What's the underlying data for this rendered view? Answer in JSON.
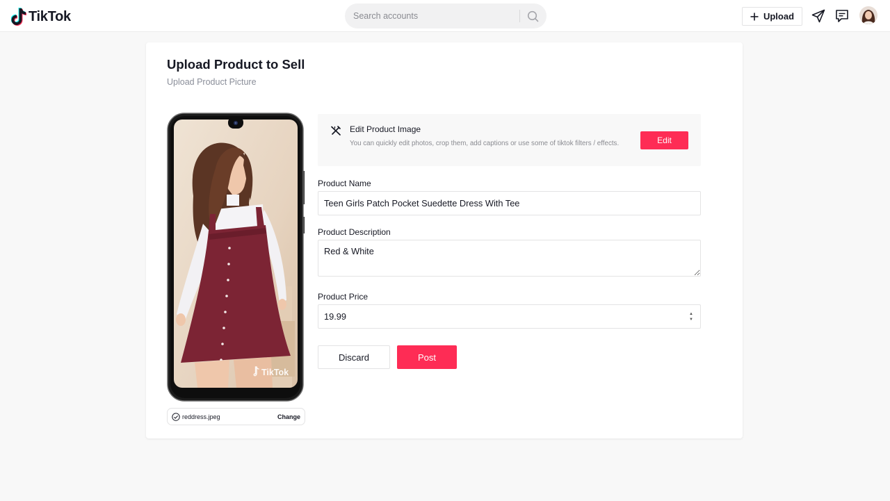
{
  "header": {
    "logo_text": "TikTok",
    "search_placeholder": "Search accounts",
    "upload_label": "Upload",
    "brand_color": "#fe2c55",
    "icons": [
      "tiktok-logo-icon",
      "search-icon",
      "plus-icon",
      "send-icon",
      "message-icon",
      "avatar"
    ]
  },
  "main": {
    "title": "Upload Product to Sell",
    "subtitle": "Upload Product Picture",
    "preview": {
      "watermark": "TikTok",
      "file_name": "reddress.jpeg",
      "change_label": "Change"
    },
    "edit_panel": {
      "title": "Edit Product Image",
      "description": "You can quickly edit photos, crop them, add captions or use some of tiktok filters / effects.",
      "button_label": "Edit"
    },
    "form": {
      "name_label": "Product Name",
      "name_value": "Teen Girls Patch Pocket Suedette Dress With Tee",
      "description_label": "Product Description",
      "description_value": "Red & White",
      "price_label": "Product Price",
      "price_value": "19.99"
    },
    "actions": {
      "discard_label": "Discard",
      "post_label": "Post"
    }
  }
}
